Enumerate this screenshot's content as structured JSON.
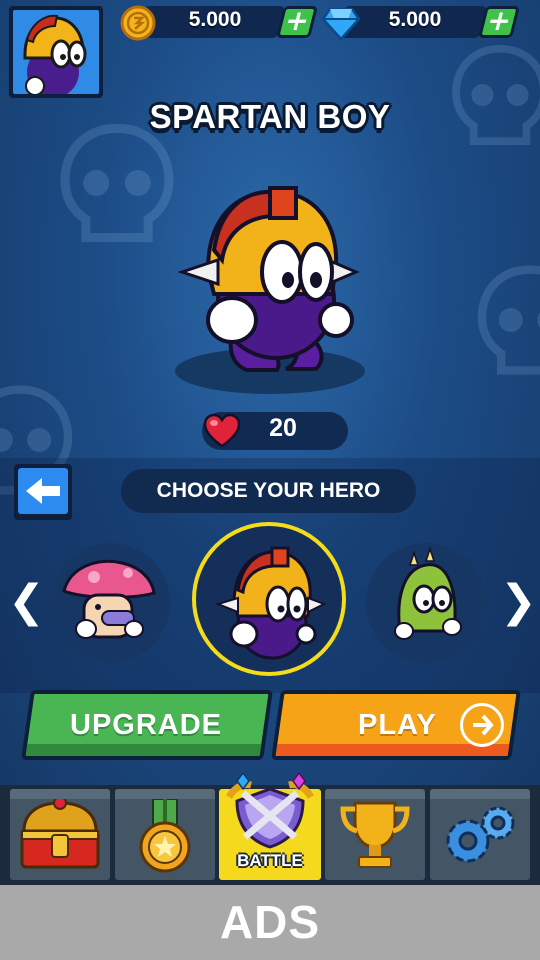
{
  "currency": {
    "coins": "5.000",
    "gems": "5.000",
    "add_label": "+"
  },
  "hero": {
    "name": "SPARTAN BOY",
    "health": "20"
  },
  "selector": {
    "title": "CHOOSE YOUR HERO",
    "prev_label": "❮",
    "next_label": "❯",
    "heroes": [
      "mushroom",
      "spartan",
      "cactus"
    ],
    "selected_index": 1
  },
  "actions": {
    "upgrade_label": "UPGRADE",
    "play_label": "PLAY"
  },
  "nav": {
    "tabs": [
      "chest-icon",
      "medal-icon",
      "battle-icon",
      "trophy-icon",
      "settings-icon"
    ],
    "battle_label": "BATTLE",
    "active_index": 2
  },
  "ads": {
    "label": "ADS"
  },
  "colors": {
    "background": "#1c4c86",
    "upgrade": "#49b553",
    "play": "#f7a318",
    "highlight": "#f5dc1b",
    "heart": "#e0233a"
  }
}
